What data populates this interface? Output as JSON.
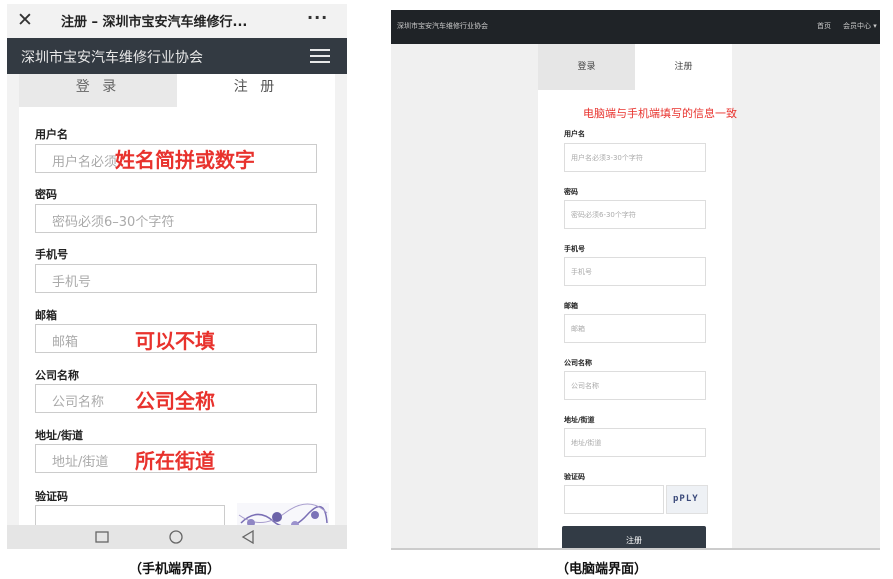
{
  "mobile": {
    "close_glyph": "✕",
    "title": "注册 – 深圳市宝安汽车维修行...",
    "more_glyph": "···",
    "brand": "深圳市宝安汽车维修行业协会",
    "tabs": {
      "login": "登 录",
      "register": "注 册"
    },
    "fields": {
      "username": {
        "label": "用户名",
        "placeholder": "用户名必须",
        "note": "姓名简拼或数字"
      },
      "password": {
        "label": "密码",
        "placeholder": "密码必须6–30个字符"
      },
      "phone": {
        "label": "手机号",
        "placeholder": "手机号"
      },
      "email": {
        "label": "邮箱",
        "placeholder": "邮箱",
        "note": "可以不填"
      },
      "company": {
        "label": "公司名称",
        "placeholder": "公司名称",
        "note": "公司全称"
      },
      "address": {
        "label": "地址/街道",
        "placeholder": "地址/街道",
        "note": "所在街道"
      },
      "captcha": {
        "label": "验证码"
      }
    },
    "caption": "（手机端界面）"
  },
  "desktop": {
    "site_title": "深圳市宝安汽车维修行业协会",
    "nav": {
      "home": "首页",
      "member": "会员中心 ▾"
    },
    "tabs": {
      "login": "登录",
      "register": "注册"
    },
    "note": "电脑端与手机端填写的信息一致",
    "fields": {
      "username": {
        "label": "用户名",
        "placeholder": "用户名必须3-30个字符"
      },
      "password": {
        "label": "密码",
        "placeholder": "密码必须6-30个字符"
      },
      "phone": {
        "label": "手机号",
        "placeholder": "手机号"
      },
      "email": {
        "label": "邮箱",
        "placeholder": "邮箱"
      },
      "company": {
        "label": "公司名称",
        "placeholder": "公司名称"
      },
      "address": {
        "label": "地址/街道",
        "placeholder": "地址/街道"
      },
      "captcha": {
        "label": "验证码",
        "image_text": "pPLY"
      }
    },
    "submit": "注册",
    "caption": "（电脑端界面）"
  },
  "colors": {
    "annotation_red": "#e8322d",
    "nav_dark": "#333a42",
    "button_dark": "#323b45"
  }
}
